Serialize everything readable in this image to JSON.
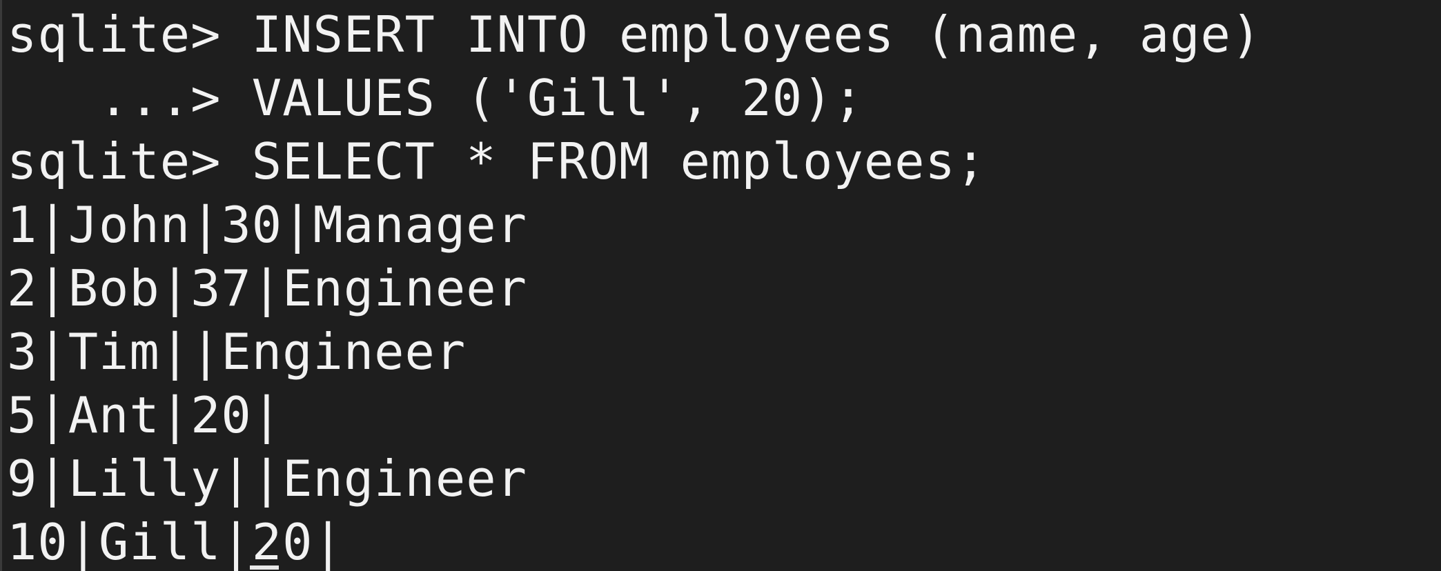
{
  "terminal": {
    "lines": [
      "sqlite> INSERT INTO employees (name, age)",
      "   ...> VALUES ('Gill', 20);",
      "sqlite> SELECT * FROM employees;",
      "1|John|30|Manager",
      "2|Bob|37|Engineer",
      "3|Tim||Engineer",
      "5|Ant|20|",
      "9|Lilly||Engineer",
      "10|Gill|20|"
    ]
  }
}
